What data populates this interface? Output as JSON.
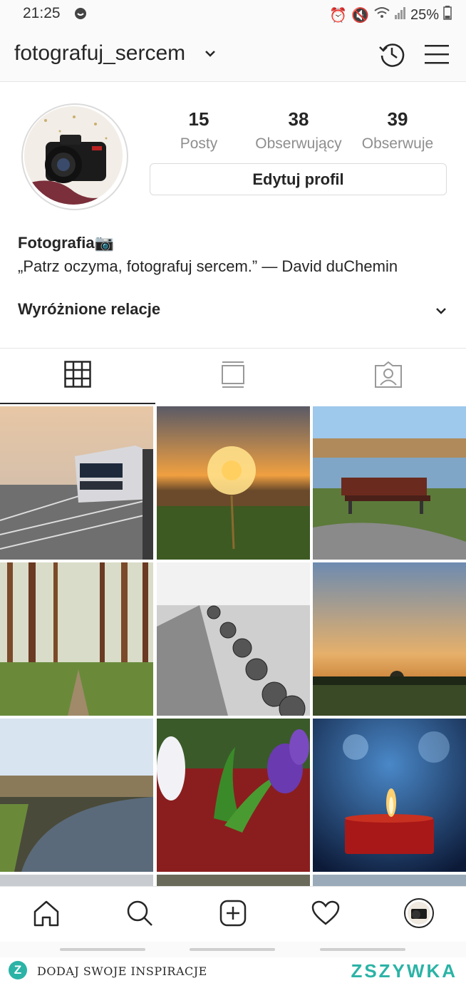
{
  "status_bar": {
    "time": "21:25",
    "battery": "25%"
  },
  "header": {
    "username": "fotografuj_sercem"
  },
  "profile": {
    "stats": [
      {
        "value": "15",
        "label": "Posty"
      },
      {
        "value": "38",
        "label": "Obserwujący"
      },
      {
        "value": "39",
        "label": "Obserwuje"
      }
    ],
    "edit_button": "Edytuj profil",
    "name": "Fotografia📷",
    "bio": "„Patrz oczyma, fotografuj sercem.” — David duChemin",
    "highlights_label": "Wyróżnione relacje"
  },
  "tabs": [
    {
      "icon": "grid-icon",
      "active": true
    },
    {
      "icon": "feed-icon",
      "active": false
    },
    {
      "icon": "tagged-icon",
      "active": false
    }
  ],
  "grid": [
    "train-photo",
    "dandelion-photo",
    "bench-photo",
    "forest-photo",
    "woodpile-photo",
    "sunset-photo",
    "river-photo",
    "flowers-photo",
    "candle-photo"
  ],
  "bottom_nav": [
    "home-icon",
    "search-icon",
    "add-icon",
    "heart-icon",
    "profile-avatar"
  ],
  "footer": {
    "text": "DODAJ SWOJE INSPIRACJE",
    "brand": "ZSZYWKA",
    "logo_letter": "Z"
  },
  "colors": {
    "brand": "#2bb3a6",
    "text": "#262626",
    "muted": "#8e8e8e",
    "border": "#dbdbdb"
  }
}
